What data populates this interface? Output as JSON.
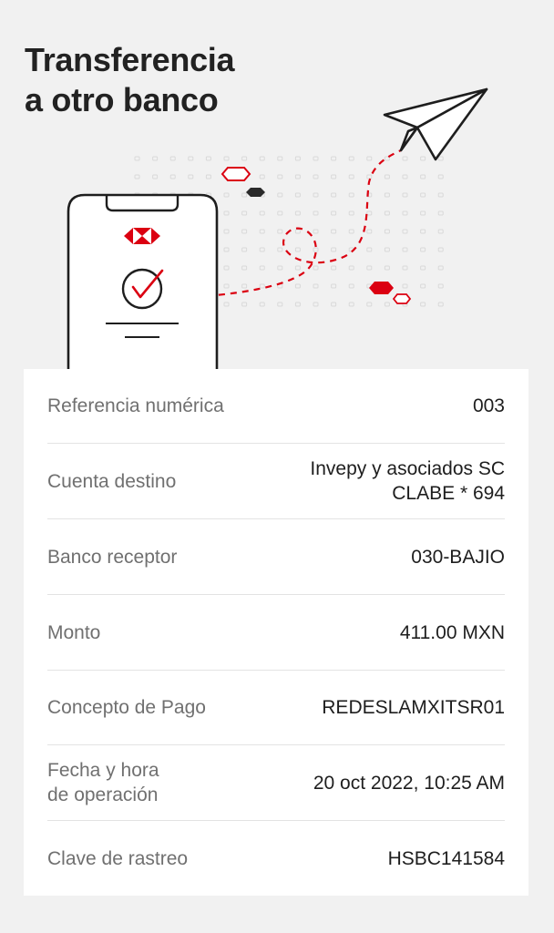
{
  "header": {
    "title_line1": "Transferencia",
    "title_line2": "a otro banco"
  },
  "illustration": {
    "icons": [
      "phone-icon",
      "hsbc-logo-icon",
      "checkmark-icon",
      "paper-plane-icon"
    ],
    "accent_color": "#db0011"
  },
  "details": {
    "rows": [
      {
        "label": "Referencia numérica",
        "value": "003"
      },
      {
        "label": "Cuenta destino",
        "value_line1": "Invepy y asociados SC",
        "value_line2": "CLABE * 694"
      },
      {
        "label": "Banco receptor",
        "value": "030-BAJIO"
      },
      {
        "label": "Monto",
        "value": "411.00 MXN"
      },
      {
        "label": "Concepto de Pago",
        "value": "REDESLAMXITSR01"
      },
      {
        "label_line1": "Fecha y hora",
        "label_line2": "de operación",
        "value": "20 oct 2022, 10:25 AM"
      },
      {
        "label": "Clave de rastreo",
        "value": "HSBC141584"
      }
    ]
  }
}
